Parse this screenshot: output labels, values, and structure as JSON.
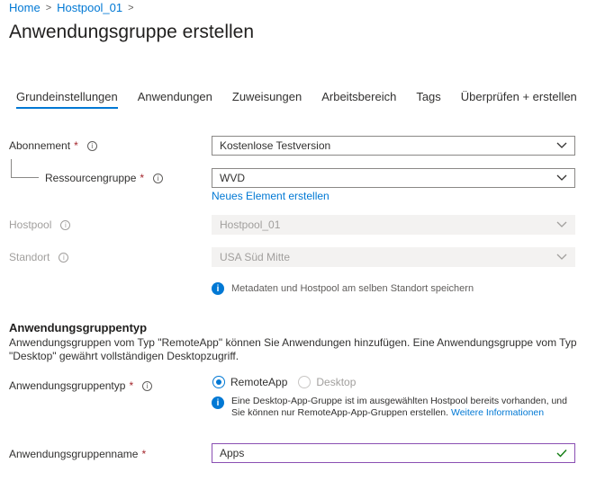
{
  "breadcrumb": {
    "home": "Home",
    "hostpool": "Hostpool_01"
  },
  "page_title": "Anwendungsgruppe erstellen",
  "tabs": [
    {
      "label": "Grundeinstellungen",
      "active": true
    },
    {
      "label": "Anwendungen"
    },
    {
      "label": "Zuweisungen"
    },
    {
      "label": "Arbeitsbereich"
    },
    {
      "label": "Tags"
    },
    {
      "label": "Überprüfen + erstellen"
    }
  ],
  "form": {
    "subscription": {
      "label": "Abonnement",
      "required": "*",
      "value": "Kostenlose Testversion"
    },
    "resource_group": {
      "label": "Ressourcengruppe",
      "required": "*",
      "value": "WVD",
      "create_link": "Neues Element erstellen"
    },
    "hostpool": {
      "label": "Hostpool",
      "value": "Hostpool_01"
    },
    "location": {
      "label": "Standort",
      "value": "USA Süd Mitte"
    },
    "location_note": "Metadaten und Hostpool am selben Standort speichern"
  },
  "app_group_type": {
    "heading": "Anwendungsgruppentyp",
    "description": "Anwendungsgruppen vom Typ \"RemoteApp\" können Sie Anwendungen hinzufügen. Eine Anwendungsgruppe vom Typ \"Desktop\" gewährt vollständigen Desktopzugriff.",
    "label": "Anwendungsgruppentyp",
    "required": "*",
    "options": [
      {
        "label": "RemoteApp",
        "selected": true
      },
      {
        "label": "Desktop",
        "selected": false
      }
    ],
    "note": "Eine Desktop-App-Gruppe ist im ausgewählten Hostpool bereits vorhanden, und Sie können nur RemoteApp-App-Gruppen erstellen.",
    "note_link": "Weitere Informationen"
  },
  "app_group_name": {
    "label": "Anwendungsgruppenname",
    "required": "*",
    "value": "Apps"
  },
  "colors": {
    "accent": "#0078d4",
    "required": "#a4262c",
    "valid": "#107c10"
  }
}
